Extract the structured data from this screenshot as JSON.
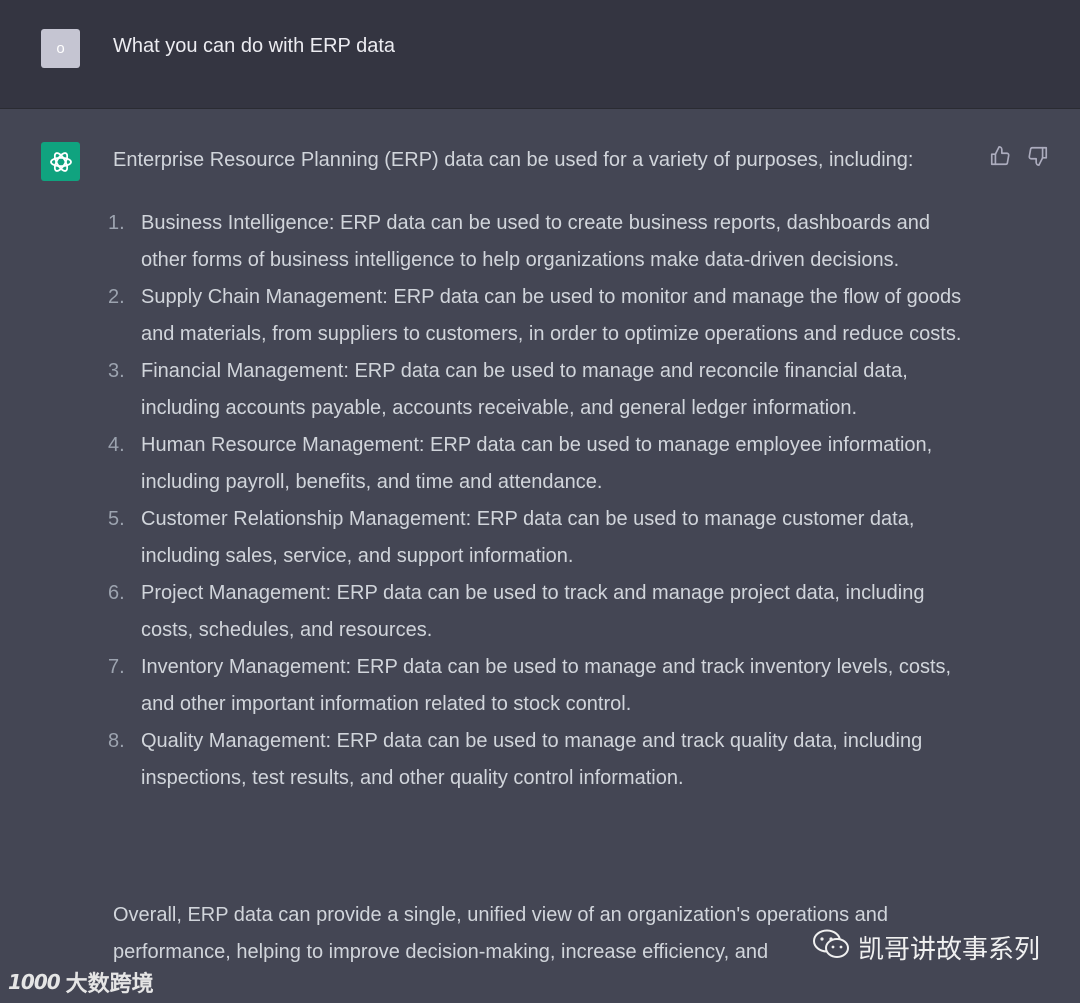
{
  "user_message": {
    "avatar_letter": "o",
    "text": "What you can do with ERP data"
  },
  "assistant_message": {
    "intro": "Enterprise Resource Planning (ERP) data can be used for a variety of purposes, including:",
    "items": [
      {
        "num": "1.",
        "text": "Business Intelligence: ERP data can be used to create business reports, dashboards and other forms of business intelligence to help organizations make data-driven decisions."
      },
      {
        "num": "2.",
        "text": "Supply Chain Management: ERP data can be used to monitor and manage the flow of goods and materials, from suppliers to customers, in order to optimize operations and reduce costs."
      },
      {
        "num": "3.",
        "text": "Financial Management: ERP data can be used to manage and reconcile financial data, including accounts payable, accounts receivable, and general ledger information."
      },
      {
        "num": "4.",
        "text": "Human Resource Management: ERP data can be used to manage employee information, including payroll, benefits, and time and attendance."
      },
      {
        "num": "5.",
        "text": "Customer Relationship Management: ERP data can be used to manage customer data, including sales, service, and support information."
      },
      {
        "num": "6.",
        "text": "Project Management: ERP data can be used to track and manage project data, including costs, schedules, and resources."
      },
      {
        "num": "7.",
        "text": "Inventory Management: ERP data can be used to manage and track inventory levels, costs, and other important information related to stock control."
      },
      {
        "num": "8.",
        "text": "Quality Management: ERP data can be used to manage and track quality data, including inspections, test results, and other quality control information."
      }
    ],
    "summary": "Overall, ERP data can provide a single, unified view of an organization's operations and performance, helping to improve decision-making, increase efficiency, and"
  },
  "icons": {
    "thumbs_up": "thumbs-up-icon",
    "thumbs_down": "thumbs-down-icon",
    "assistant_logo": "openai-logo-icon"
  },
  "colors": {
    "user_bg": "#343541",
    "assistant_bg": "#444654",
    "bot_avatar": "#10a37f",
    "text": "#d1d5db"
  },
  "watermarks": {
    "left_logo": "1000",
    "left_text": "大数跨境",
    "right_text": "凯哥讲故事系列"
  }
}
